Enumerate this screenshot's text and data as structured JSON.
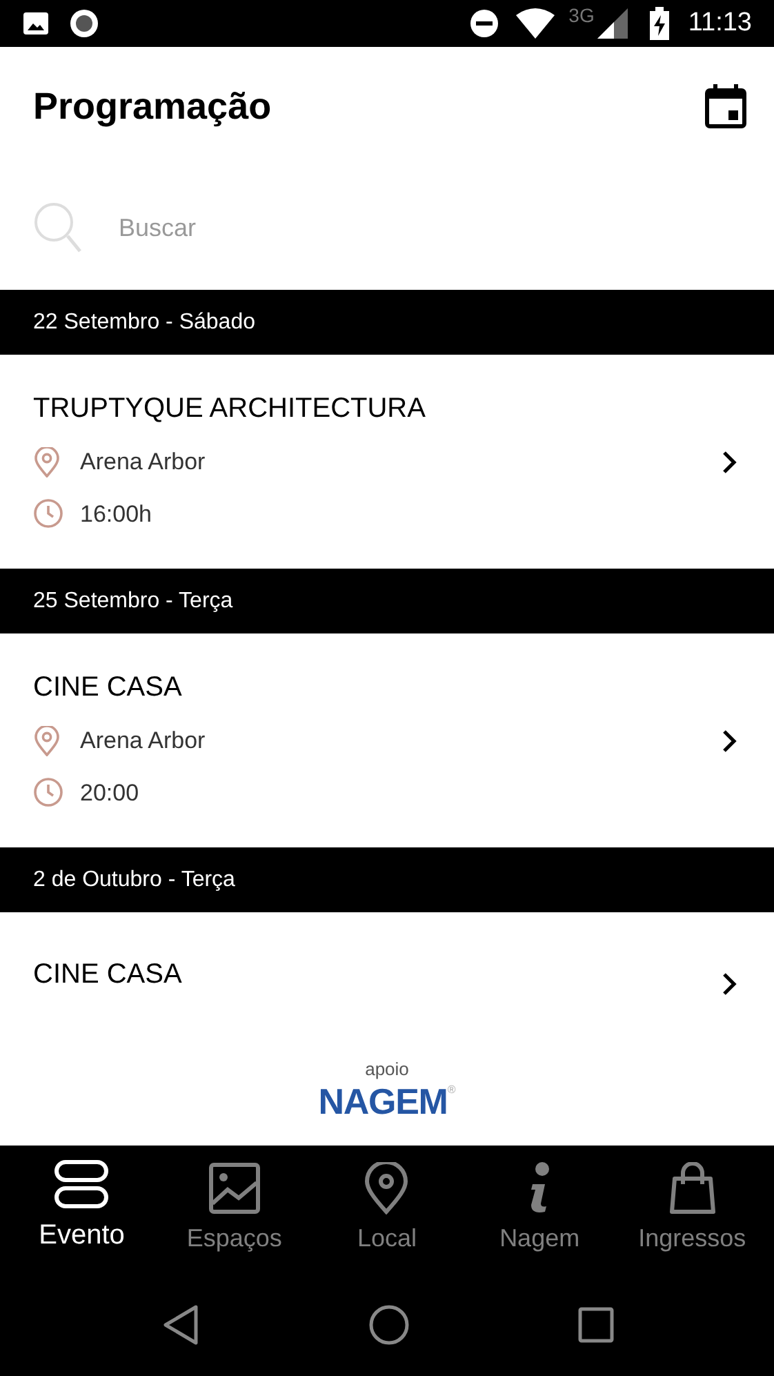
{
  "status_bar": {
    "network": "3G",
    "time": "11:13"
  },
  "header": {
    "title": "Programação"
  },
  "search": {
    "placeholder": "Buscar"
  },
  "days": [
    {
      "date": "22 Setembro - Sábado",
      "events": [
        {
          "title": "TRUPTYQUE ARCHITECTURA",
          "place": "Arena Arbor",
          "time": "16:00h"
        }
      ]
    },
    {
      "date": "25 Setembro - Terça",
      "events": [
        {
          "title": "CINE CASA",
          "place": "Arena Arbor",
          "time": "20:00"
        }
      ]
    },
    {
      "date": "2 de Outubro - Terça",
      "events": [
        {
          "title": "CINE CASA"
        }
      ]
    }
  ],
  "sponsor": {
    "label": "apoio",
    "logo": "NAGEM",
    "logo_mark": "®"
  },
  "tabs": [
    {
      "kind": "evento",
      "label": "Evento",
      "selected": true
    },
    {
      "kind": "espacos",
      "label": "Espaços",
      "selected": false
    },
    {
      "kind": "local",
      "label": "Local",
      "selected": false
    },
    {
      "kind": "nagem",
      "label": "Nagem",
      "selected": false
    },
    {
      "kind": "ingressos",
      "label": "Ingressos",
      "selected": false
    }
  ]
}
